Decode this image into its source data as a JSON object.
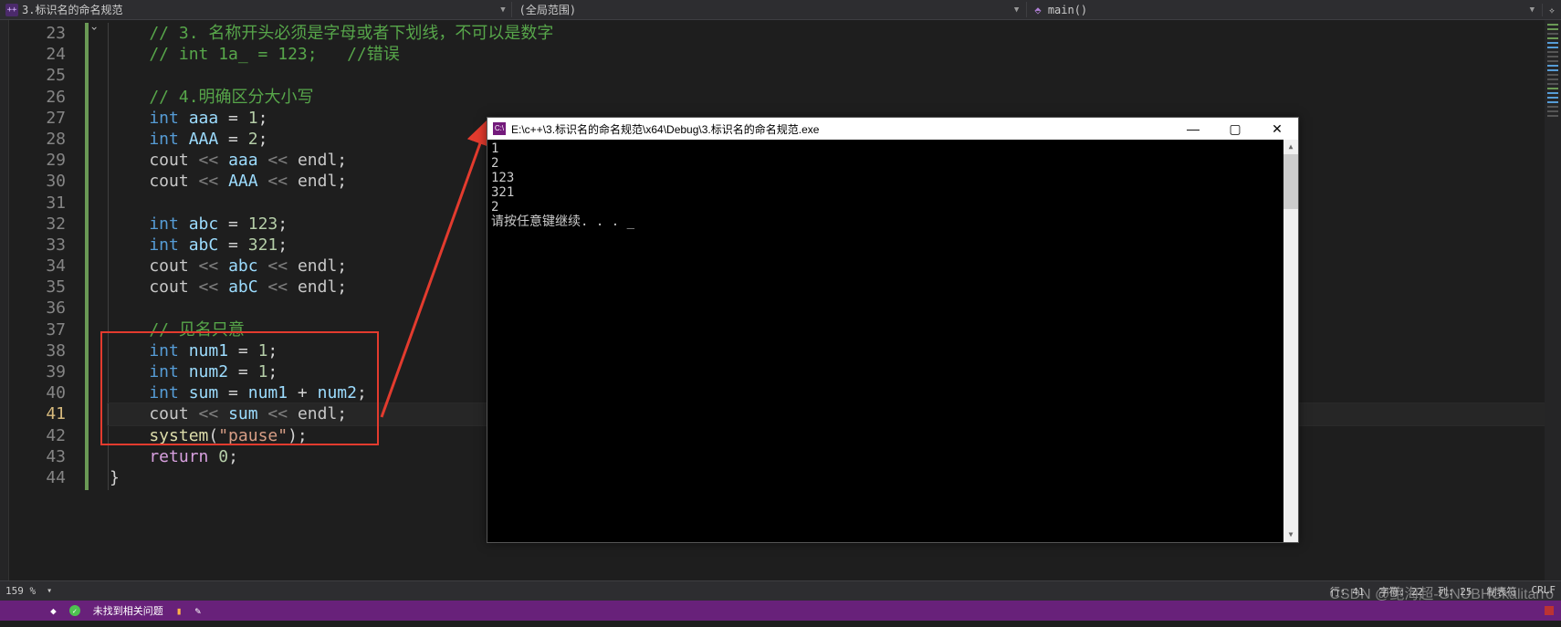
{
  "topbar": {
    "filename": "3.标识名的命名规范",
    "scope": "(全局范围)",
    "func_icon": "cube",
    "func": "main()"
  },
  "editor": {
    "first_line_no": 23,
    "current_line_no": 41,
    "lines": [
      {
        "n": 23,
        "seg": [
          {
            "c": "c-com",
            "t": "    // 3. 名称开头必须是字母或者下划线，不可以是数字"
          }
        ]
      },
      {
        "n": 24,
        "seg": [
          {
            "c": "c-com",
            "t": "    // int 1a_ = 123;   //错误"
          }
        ]
      },
      {
        "n": 25,
        "seg": []
      },
      {
        "n": 26,
        "seg": [
          {
            "c": "c-com",
            "t": "    // 4.明确区分大小写"
          }
        ]
      },
      {
        "n": 27,
        "seg": [
          {
            "c": "c-kw",
            "t": "    int "
          },
          {
            "c": "c-id",
            "t": "aaa"
          },
          {
            "c": "c-pun",
            "t": " = "
          },
          {
            "c": "c-num",
            "t": "1"
          },
          {
            "c": "c-pun",
            "t": ";"
          }
        ]
      },
      {
        "n": 28,
        "seg": [
          {
            "c": "c-kw",
            "t": "    int "
          },
          {
            "c": "c-id",
            "t": "AAA"
          },
          {
            "c": "c-pun",
            "t": " = "
          },
          {
            "c": "c-num",
            "t": "2"
          },
          {
            "c": "c-pun",
            "t": ";"
          }
        ]
      },
      {
        "n": 29,
        "seg": [
          {
            "c": "c-obj",
            "t": "    cout "
          },
          {
            "c": "dim",
            "t": "<< "
          },
          {
            "c": "c-id",
            "t": "aaa"
          },
          {
            "c": "dim",
            "t": " << "
          },
          {
            "c": "c-obj",
            "t": "endl"
          },
          {
            "c": "c-pun",
            "t": ";"
          }
        ]
      },
      {
        "n": 30,
        "seg": [
          {
            "c": "c-obj",
            "t": "    cout "
          },
          {
            "c": "dim",
            "t": "<< "
          },
          {
            "c": "c-id",
            "t": "AAA"
          },
          {
            "c": "dim",
            "t": " << "
          },
          {
            "c": "c-obj",
            "t": "endl"
          },
          {
            "c": "c-pun",
            "t": ";"
          }
        ]
      },
      {
        "n": 31,
        "seg": []
      },
      {
        "n": 32,
        "seg": [
          {
            "c": "c-kw",
            "t": "    int "
          },
          {
            "c": "c-id",
            "t": "abc"
          },
          {
            "c": "c-pun",
            "t": " = "
          },
          {
            "c": "c-num",
            "t": "123"
          },
          {
            "c": "c-pun",
            "t": ";"
          }
        ]
      },
      {
        "n": 33,
        "seg": [
          {
            "c": "c-kw",
            "t": "    int "
          },
          {
            "c": "c-id",
            "t": "abC"
          },
          {
            "c": "c-pun",
            "t": " = "
          },
          {
            "c": "c-num",
            "t": "321"
          },
          {
            "c": "c-pun",
            "t": ";"
          }
        ]
      },
      {
        "n": 34,
        "seg": [
          {
            "c": "c-obj",
            "t": "    cout "
          },
          {
            "c": "dim",
            "t": "<< "
          },
          {
            "c": "c-id",
            "t": "abc"
          },
          {
            "c": "dim",
            "t": " << "
          },
          {
            "c": "c-obj",
            "t": "endl"
          },
          {
            "c": "c-pun",
            "t": ";"
          }
        ]
      },
      {
        "n": 35,
        "seg": [
          {
            "c": "c-obj",
            "t": "    cout "
          },
          {
            "c": "dim",
            "t": "<< "
          },
          {
            "c": "c-id",
            "t": "abC"
          },
          {
            "c": "dim",
            "t": " << "
          },
          {
            "c": "c-obj",
            "t": "endl"
          },
          {
            "c": "c-pun",
            "t": ";"
          }
        ]
      },
      {
        "n": 36,
        "seg": []
      },
      {
        "n": 37,
        "seg": [
          {
            "c": "c-com",
            "t": "    // 见名只意"
          }
        ]
      },
      {
        "n": 38,
        "seg": [
          {
            "c": "c-kw",
            "t": "    int "
          },
          {
            "c": "c-id",
            "t": "num1"
          },
          {
            "c": "c-pun",
            "t": " = "
          },
          {
            "c": "c-num",
            "t": "1"
          },
          {
            "c": "c-pun",
            "t": ";"
          }
        ]
      },
      {
        "n": 39,
        "seg": [
          {
            "c": "c-kw",
            "t": "    int "
          },
          {
            "c": "c-id",
            "t": "num2"
          },
          {
            "c": "c-pun",
            "t": " = "
          },
          {
            "c": "c-num",
            "t": "1"
          },
          {
            "c": "c-pun",
            "t": ";"
          }
        ]
      },
      {
        "n": 40,
        "seg": [
          {
            "c": "c-kw",
            "t": "    int "
          },
          {
            "c": "c-id",
            "t": "sum"
          },
          {
            "c": "c-pun",
            "t": " = "
          },
          {
            "c": "c-id",
            "t": "num1"
          },
          {
            "c": "c-pun",
            "t": " + "
          },
          {
            "c": "c-id",
            "t": "num2"
          },
          {
            "c": "c-pun",
            "t": ";"
          }
        ]
      },
      {
        "n": 41,
        "seg": [
          {
            "c": "c-obj",
            "t": "    cout "
          },
          {
            "c": "dim",
            "t": "<< "
          },
          {
            "c": "c-id",
            "t": "sum"
          },
          {
            "c": "dim",
            "t": " << "
          },
          {
            "c": "c-obj",
            "t": "endl"
          },
          {
            "c": "c-pun",
            "t": ";"
          }
        ]
      },
      {
        "n": 42,
        "seg": [
          {
            "c": "c-fun",
            "t": "    system"
          },
          {
            "c": "c-pun",
            "t": "("
          },
          {
            "c": "c-str",
            "t": "\"pause\""
          },
          {
            "c": "c-pun",
            "t": ");"
          }
        ]
      },
      {
        "n": 43,
        "seg": [
          {
            "c": "c-kw2",
            "t": "    return "
          },
          {
            "c": "c-num",
            "t": "0"
          },
          {
            "c": "c-pun",
            "t": ";"
          }
        ]
      },
      {
        "n": 44,
        "seg": [
          {
            "c": "c-pun",
            "t": "}"
          }
        ]
      }
    ]
  },
  "console": {
    "title": "E:\\c++\\3.标识名的命名规范\\x64\\Debug\\3.标识名的命名规范.exe",
    "output": "1\n2\n123\n321\n2\n请按任意键继续. . . _"
  },
  "infobar": {
    "zoom": "159 %",
    "issues": "未找到相关问题",
    "line": "行: 41",
    "char": "字符: 22",
    "col": "列: 25",
    "tabs": "制表符",
    "eol": "CRLF"
  },
  "watermark": "CSDN @鲍海超-GNUBHCkalitarro"
}
